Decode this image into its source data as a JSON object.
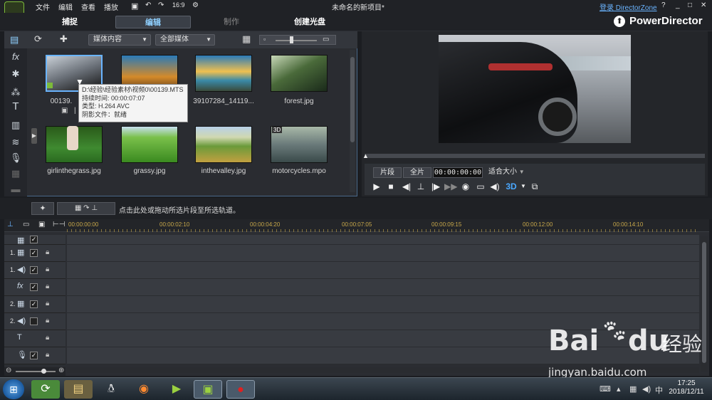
{
  "menu": {
    "file": "文件",
    "edit": "编辑",
    "view": "查看",
    "play": "播放"
  },
  "window": {
    "title": "未命名的新项目*",
    "login": "登录 DirectorZone",
    "help": "?",
    "brand": "PowerDirector",
    "tc_mode": "16:9"
  },
  "tabs": {
    "capture": "捕捉",
    "edit": "编辑",
    "produce": "制作",
    "disc": "创建光盘"
  },
  "library": {
    "filter": "媒体内容",
    "type": "全部媒体",
    "items": [
      {
        "label": "00139.",
        "color": "#2a3038"
      },
      {
        "label": "",
        "color": "#d48a2a"
      },
      {
        "label": "39107284_14119...",
        "color": "#3a8aa8"
      },
      {
        "label": "forest.jpg",
        "color": "#4a6a3a"
      },
      {
        "label": "girlinthegrass.jpg",
        "color": "#3f8a30"
      },
      {
        "label": "grassy.jpg",
        "color": "#5caa3a"
      },
      {
        "label": "inthevalley.jpg",
        "color": "#c2a040"
      },
      {
        "label": "motorcycles.mpo",
        "color": "#6a7a7a"
      }
    ],
    "badge_3d": "3D"
  },
  "tooltip": {
    "path": "D:\\经验\\经验素材\\视频0\\00139.MTS",
    "duration": "持续时间: 00:00:07:07",
    "type": "类型: H.264 AVC",
    "shadow": "阴影文件：就绪"
  },
  "preview": {
    "clip": "片段",
    "full": "全片",
    "timecode": "00:00:00:00",
    "fit": "适合大小",
    "mode3d": "3D"
  },
  "midstrip": {
    "hint": "点击此处或拖动所选片段至所选轨道。"
  },
  "timeline": {
    "ticks": [
      "00:00:00:00",
      "00:00:02:10",
      "00:00:04:20",
      "00:00:07:05",
      "00:00:09:15",
      "00:00:12:00",
      "00:00:14:10"
    ],
    "tracks": [
      {
        "num": "",
        "icon": "▦",
        "checked": true
      },
      {
        "num": "1.",
        "icon": "▦",
        "checked": true
      },
      {
        "num": "1.",
        "icon": "◀",
        "checked": true
      },
      {
        "num": "",
        "icon": "fx",
        "checked": true
      },
      {
        "num": "2.",
        "icon": "▦",
        "checked": true
      },
      {
        "num": "2.",
        "icon": "◀",
        "checked": false
      },
      {
        "num": "",
        "icon": "T",
        "checked": false
      },
      {
        "num": "",
        "icon": "🎤",
        "checked": true
      }
    ]
  },
  "taskbar": {
    "time": "17:25",
    "date": "2018/12/11"
  },
  "watermark": {
    "brand": "Bai",
    "brand2": "du",
    "cn": "经验",
    "url": "jingyan.baidu.com"
  }
}
